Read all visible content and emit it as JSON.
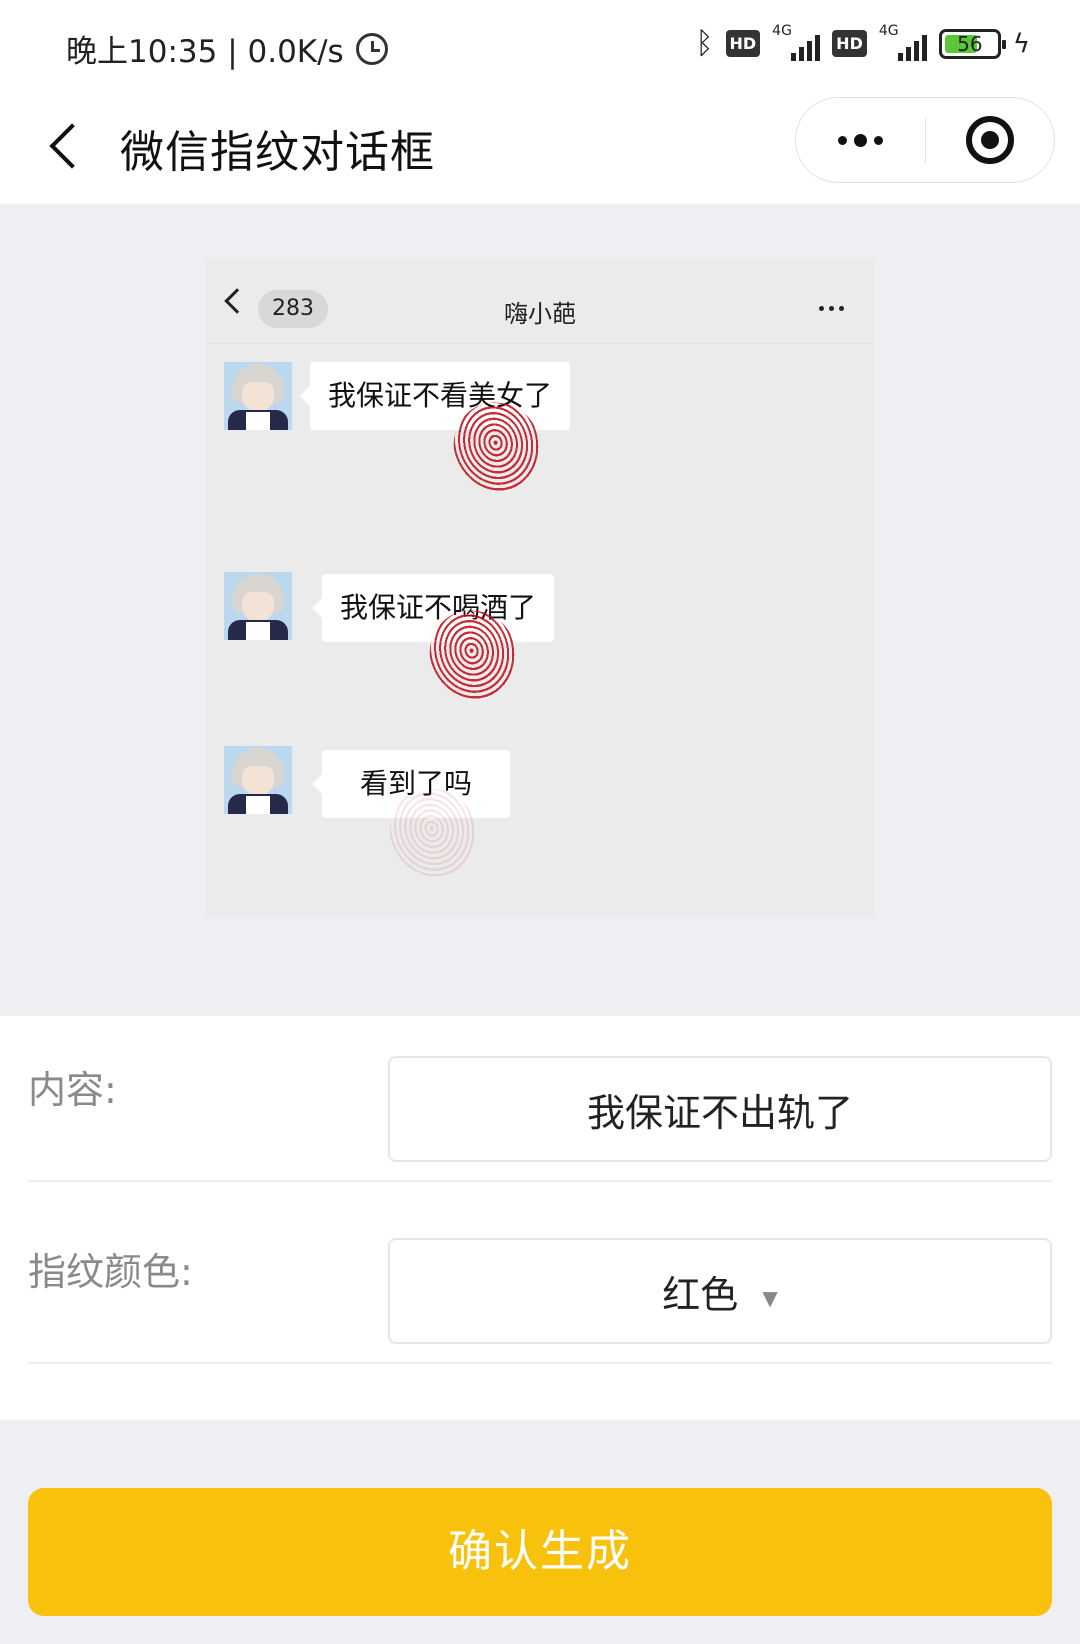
{
  "status_bar": {
    "time_speed": "晚上10:35 | 0.0K/s",
    "hd_label": "HD",
    "network_label": "4G",
    "battery_level": "56"
  },
  "navbar": {
    "title": "微信指纹对话框"
  },
  "preview": {
    "back_count": "283",
    "contact_name": "嗨小葩",
    "messages": [
      {
        "text": "我保证不看美女了"
      },
      {
        "text": "我保证不喝酒了"
      },
      {
        "text": "看到了吗"
      }
    ],
    "fingerprint_color": "#c00a14"
  },
  "form": {
    "content_label": "内容:",
    "content_value": "我保证不出轨了",
    "color_label": "指纹颜色:",
    "color_value": "红色"
  },
  "actions": {
    "confirm_label": "确认生成",
    "confirm_color": "#f8c10b"
  }
}
